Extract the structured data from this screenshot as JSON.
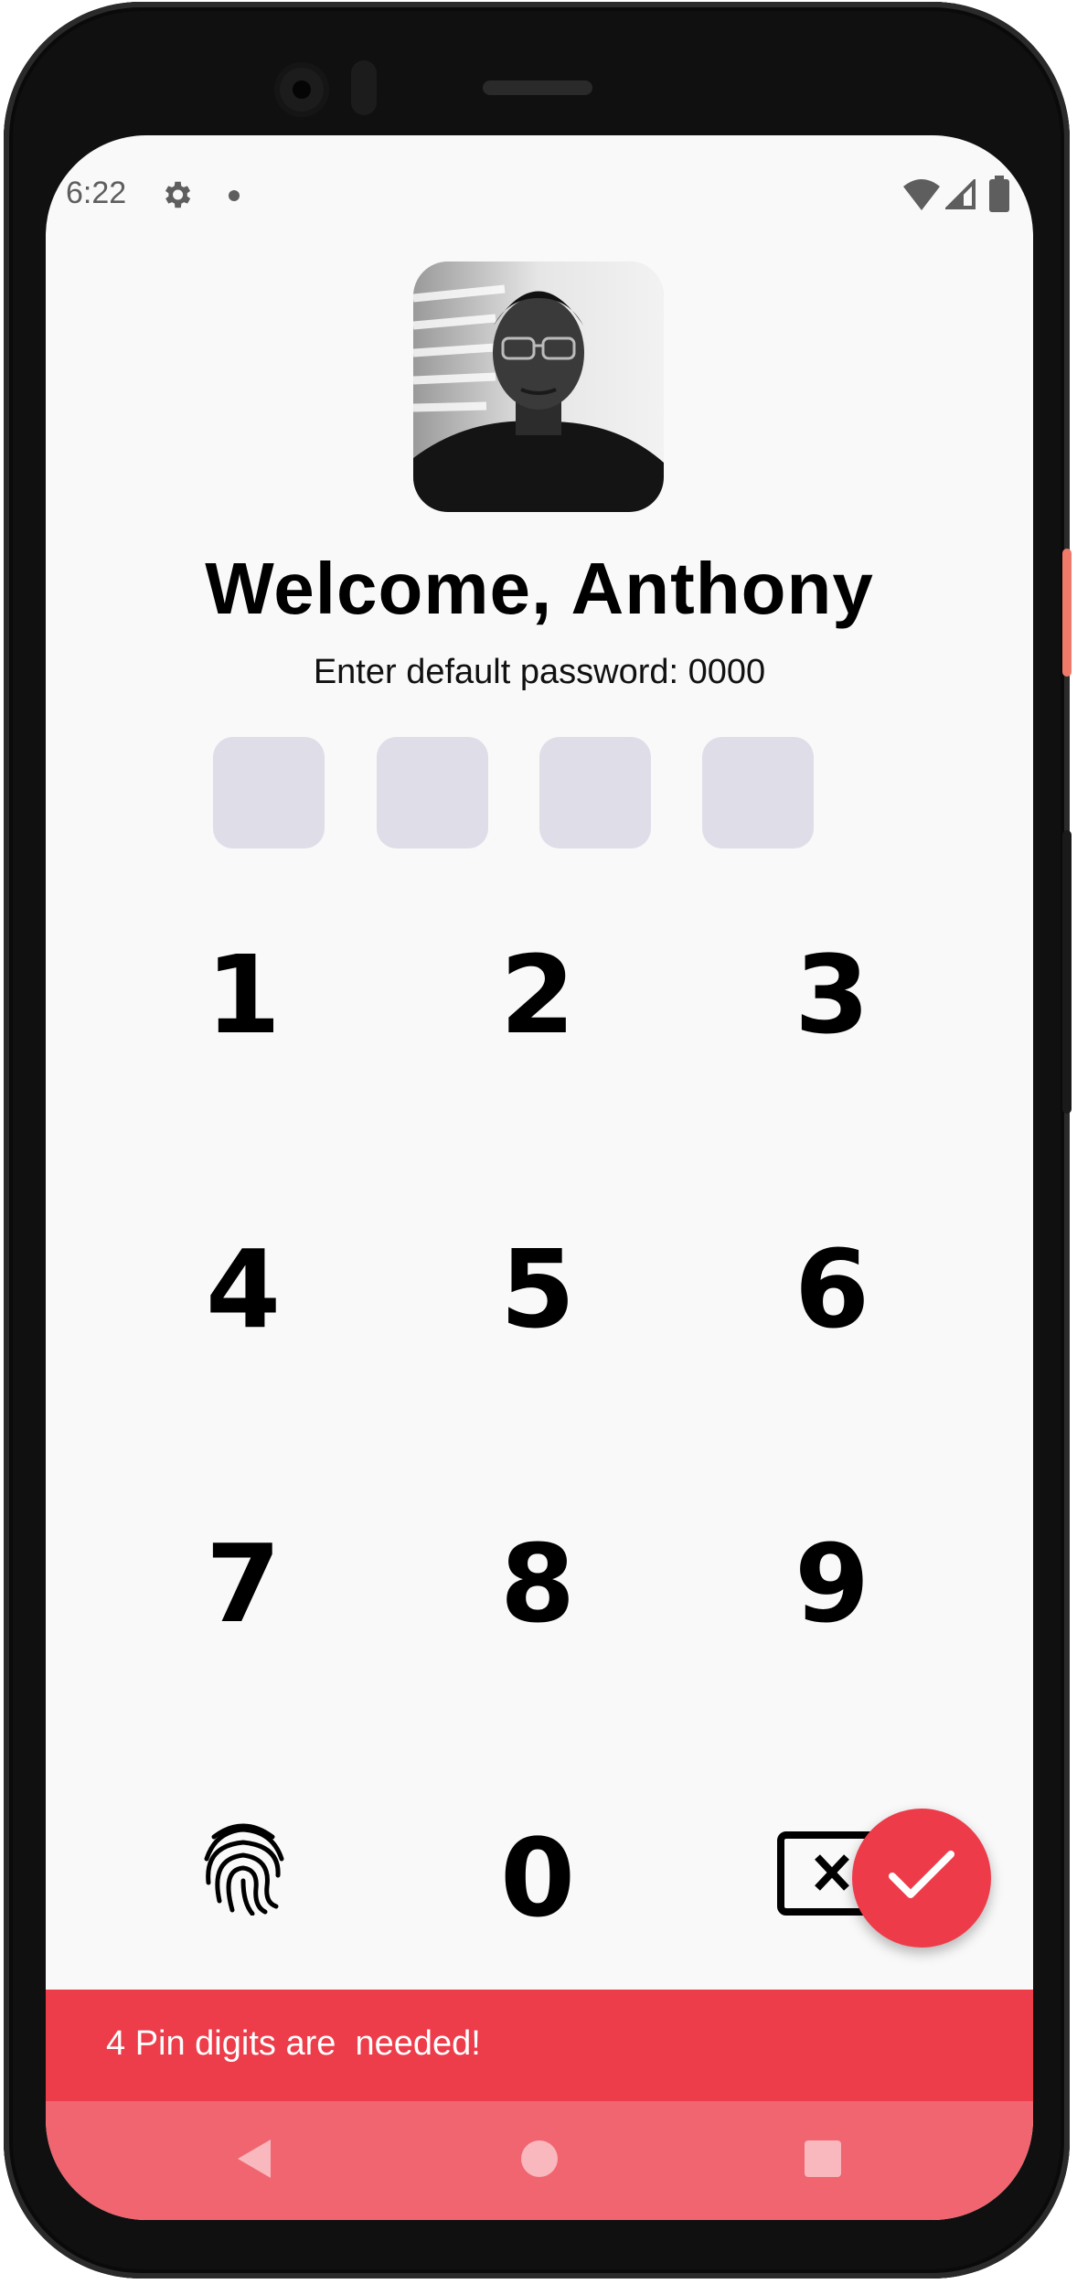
{
  "status_bar": {
    "time": "6:22",
    "icons": [
      "gear-icon",
      "notification-dot-icon",
      "wifi-icon",
      "cell-signal-icon",
      "battery-icon"
    ]
  },
  "profile": {
    "avatar": "user-photo",
    "welcome": "Welcome, Anthony",
    "subtitle": "Enter default password: 0000"
  },
  "pin": {
    "length": 4,
    "entered": 0,
    "box_color": "#dfdde8"
  },
  "keypad": {
    "keys": [
      "1",
      "2",
      "3",
      "4",
      "5",
      "6",
      "7",
      "8",
      "9",
      "0"
    ],
    "left_action": "fingerprint-icon",
    "right_action": "backspace-icon"
  },
  "submit": {
    "icon": "checkmark-icon",
    "color": "#ee3b4a"
  },
  "snackbar": {
    "message": "4 Pin digits are  needed!",
    "color": "#ed3c4a"
  },
  "navigation": {
    "icons": [
      "back-icon",
      "home-icon",
      "recents-icon"
    ],
    "color": "#f0656f"
  }
}
